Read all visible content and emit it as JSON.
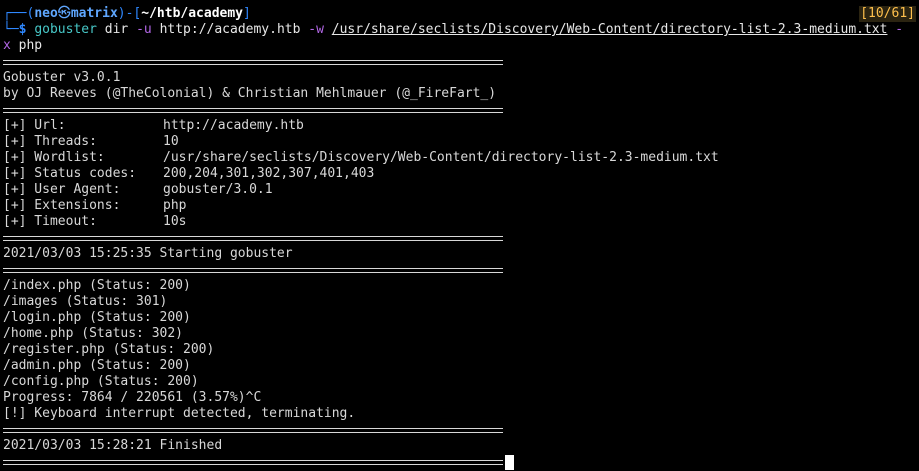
{
  "prompt": {
    "user": "neo",
    "host": "matrix",
    "path": "~/htb/academy",
    "history": "10/61"
  },
  "command": {
    "tool": "gobuster",
    "mode": "dir",
    "url_flag": "-u",
    "url": "http://academy.htb",
    "wordlist_flag": "-w",
    "wordlist": "/usr/share/seclists/Discovery/Web-Content/directory-list-2.3-medium.txt",
    "trailing_dash": "-",
    "ext_flag": "x",
    "ext": "php"
  },
  "banner": {
    "version": "Gobuster v3.0.1",
    "authors": "by OJ Reeves (@TheColonial) & Christian Mehlmauer (@_FireFart_)"
  },
  "config": [
    {
      "label": "[+] Url:",
      "value": "http://academy.htb"
    },
    {
      "label": "[+] Threads:",
      "value": "10"
    },
    {
      "label": "[+] Wordlist:",
      "value": "/usr/share/seclists/Discovery/Web-Content/directory-list-2.3-medium.txt"
    },
    {
      "label": "[+] Status codes:",
      "value": "200,204,301,302,307,401,403"
    },
    {
      "label": "[+] User Agent:",
      "value": "gobuster/3.0.1"
    },
    {
      "label": "[+] Extensions:",
      "value": "php"
    },
    {
      "label": "[+] Timeout:",
      "value": "10s"
    }
  ],
  "start_line": "2021/03/03 15:25:35 Starting gobuster",
  "results": [
    "/index.php (Status: 200)",
    "/images (Status: 301)",
    "/login.php (Status: 200)",
    "/home.php (Status: 302)",
    "/register.php (Status: 200)",
    "/admin.php (Status: 200)",
    "/config.php (Status: 200)"
  ],
  "progress": "Progress: 7864 / 220561 (3.57%)^C",
  "interrupt": "[!] Keyboard interrupt detected, terminating.",
  "finish_line": "2021/03/03 15:28:21 Finished"
}
